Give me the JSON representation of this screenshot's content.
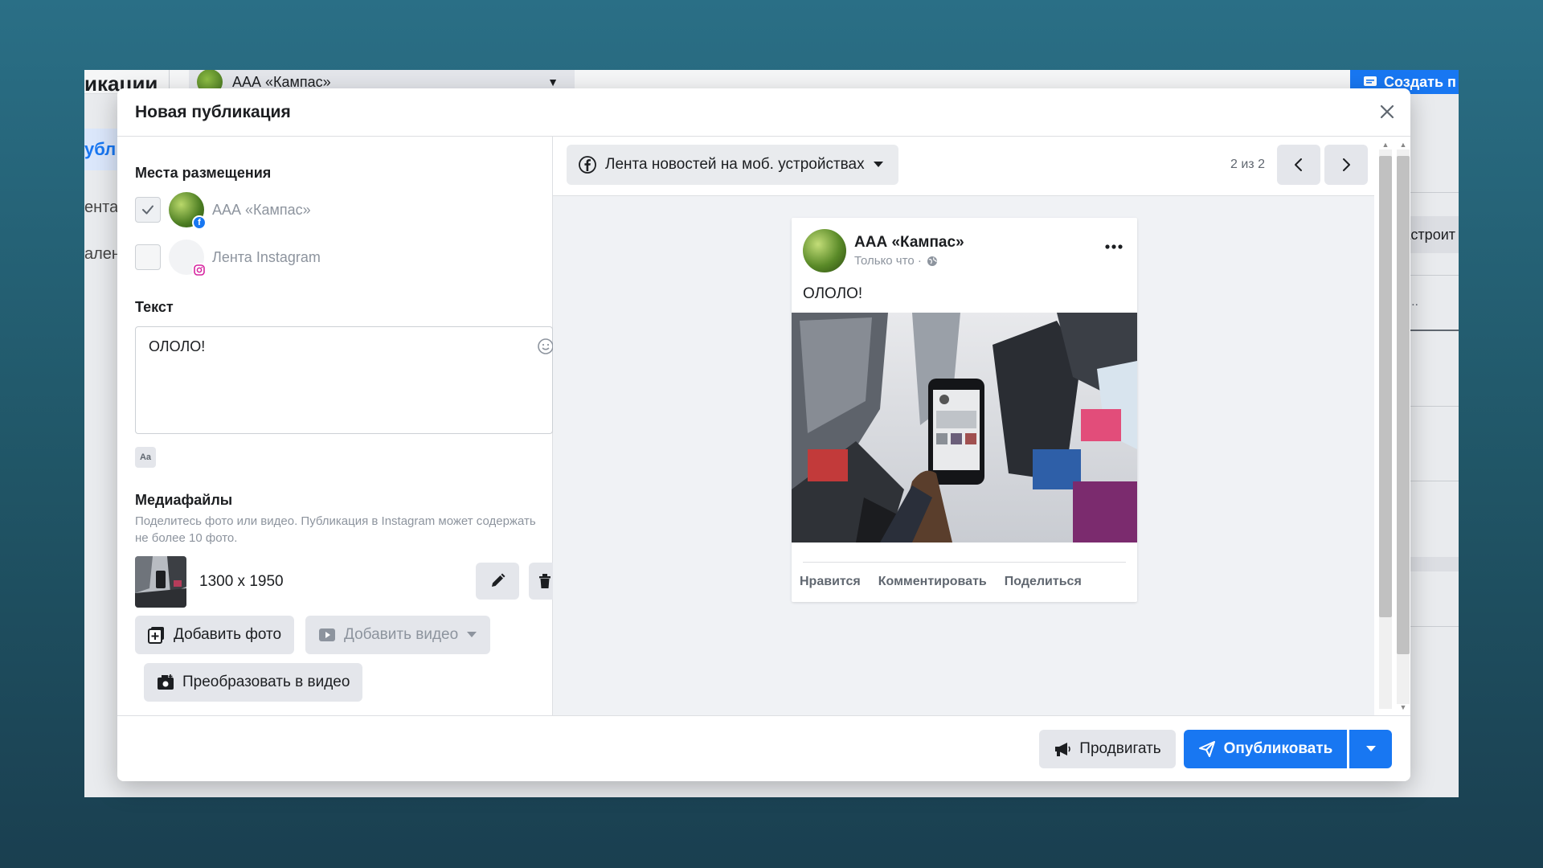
{
  "background_page": {
    "title_fragment": "икации",
    "page_name": "ААА «Кампас»",
    "create_button": "Создать п",
    "left_nav_active": "убл",
    "left_nav_items": [
      "ента",
      "ален"
    ],
    "right_button": "астроит",
    "right_ellipsis": "..."
  },
  "modal": {
    "title": "Новая публикация",
    "placements": {
      "label": "Места размещения",
      "items": [
        {
          "label": "ААА «Кампас»",
          "checked": true,
          "network": "facebook"
        },
        {
          "label": "Лента Instagram",
          "checked": false,
          "network": "instagram"
        }
      ]
    },
    "text_section": {
      "label": "Текст",
      "value": "ОЛОЛО!"
    },
    "media": {
      "label": "Медиафайлы",
      "description_line1": "Поделитесь фото или видео. Публикация в Instagram может содержать",
      "description_line2": "не более 10 фото.",
      "file_size": "1300 x 1950",
      "add_photo": "Добавить фото",
      "add_video": "Добавить видео",
      "convert_to_video": "Преобразовать в видео"
    },
    "preview": {
      "placement_select": "Лента новостей на моб. устройствах",
      "pager": "2 из 2",
      "post": {
        "page_name": "ААА «Кампас»",
        "time": "Только что ·",
        "text": "ОЛОЛО!",
        "actions": [
          "Нравится",
          "Комментировать",
          "Поделиться"
        ]
      }
    },
    "footer": {
      "promote": "Продвигать",
      "publish": "Опубликовать"
    }
  },
  "colors": {
    "accent": "#1877f2",
    "background_gradient_top": "#2a6f86",
    "background_gradient_bottom": "#1a3f50"
  }
}
